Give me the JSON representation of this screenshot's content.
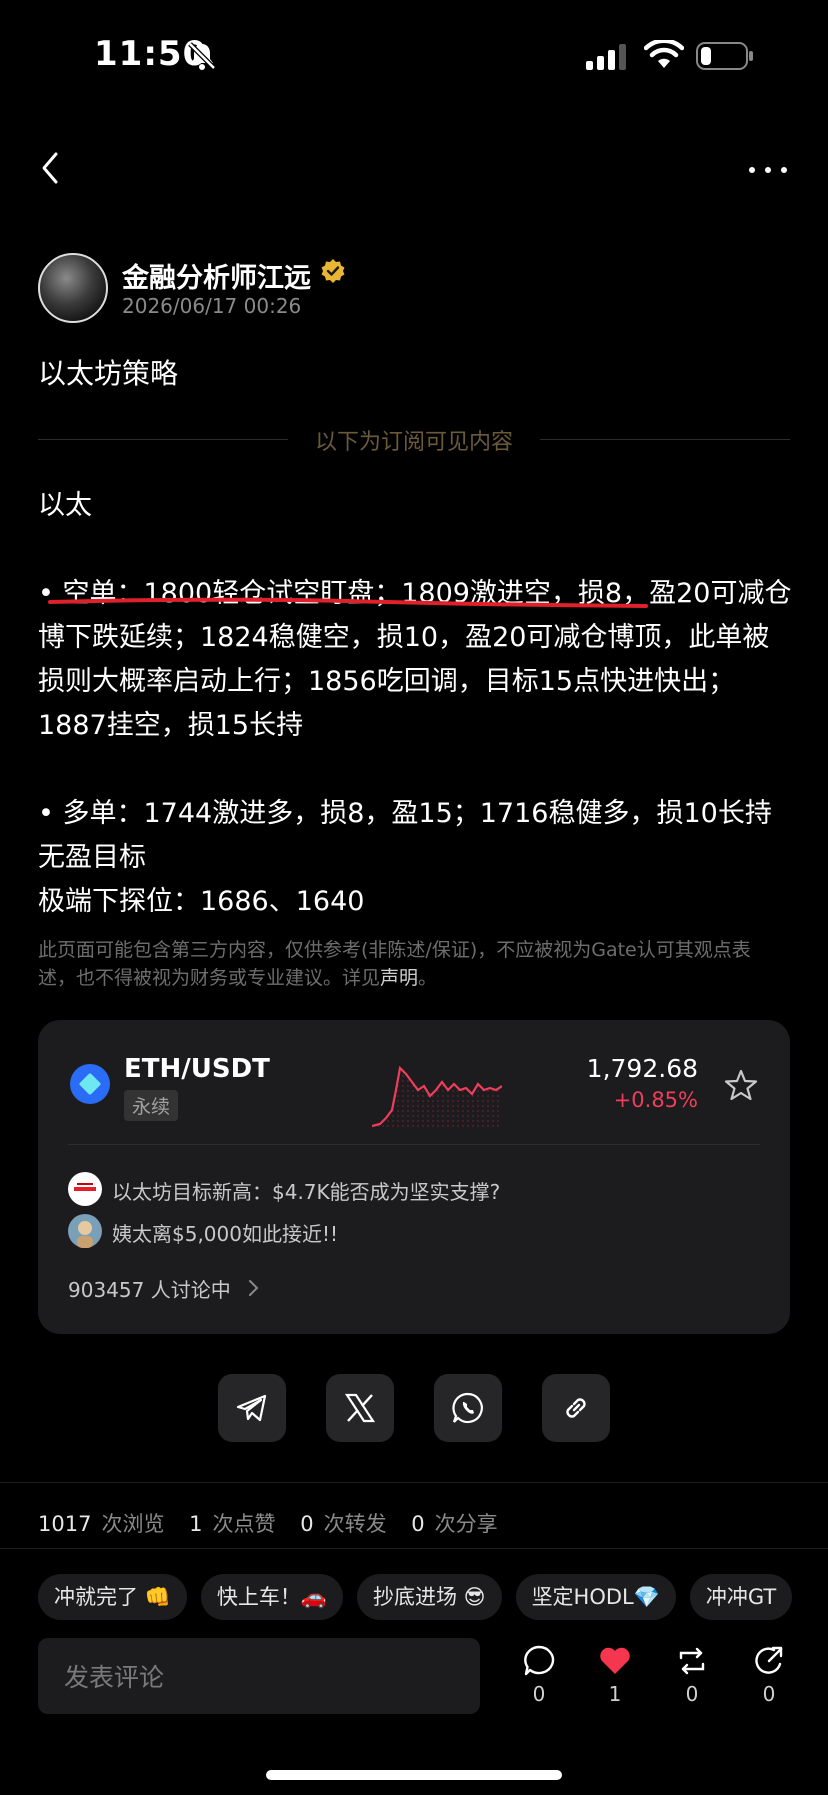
{
  "status_bar": {
    "time": "11:50"
  },
  "author": {
    "name": "金融分析师江远",
    "date": "2026/06/17 00:26"
  },
  "post": {
    "title": "以太坊策略",
    "subscriber_divider": "以下为订阅可见内容",
    "lines": {
      "heading": "以太",
      "short": "• 空单：1800轻仓试空盯盘；1809激进空，损8，盈20可减仓博下跌延续；1824稳健空，损10，盈20可减仓博顶，此单被损则大概率启动上行；1856吃回调，目标15点快进快出；1887挂空，损15长持",
      "long": "• 多单：1744激进多，损8，盈15；1716稳健多，损10长持无盈目标",
      "extreme": "极端下探位：1686、1640"
    },
    "disclaimer_text": "此页面可能包含第三方内容，仅供参考(非陈述/保证)，不应被视为Gate认可其观点表述，也不得被视为财务或专业建议。详见",
    "disclaimer_link": "声明",
    "disclaimer_end": "。"
  },
  "market_card": {
    "pair": "ETH/USDT",
    "type": "永续",
    "price": "1,792.68",
    "change": "+0.85%",
    "accent_down": "#ef3e5c",
    "news": [
      {
        "title": "以太坊目标新高：$4.7K能否成为坚实支撑?"
      },
      {
        "title": "姨太离$5,000如此接近!!"
      }
    ],
    "discussion": "903457 人讨论中"
  },
  "share": [
    "telegram-icon",
    "x-icon",
    "whatsapp-icon",
    "link-icon"
  ],
  "stats": {
    "views": "1017",
    "views_unit": "次浏览",
    "likes": "1",
    "likes_unit": "次点赞",
    "reposts": "0",
    "reposts_unit": "次转发",
    "shares": "0",
    "shares_unit": "次分享"
  },
  "chips": [
    "冲就完了 👊",
    "快上车！🚗",
    "抄底进场 😎",
    "坚定HODL💎",
    "冲冲GT"
  ],
  "comment": {
    "placeholder": "发表评论"
  },
  "actions": {
    "comments": "0",
    "likes": "1",
    "reposts": "0",
    "shares": "0"
  }
}
